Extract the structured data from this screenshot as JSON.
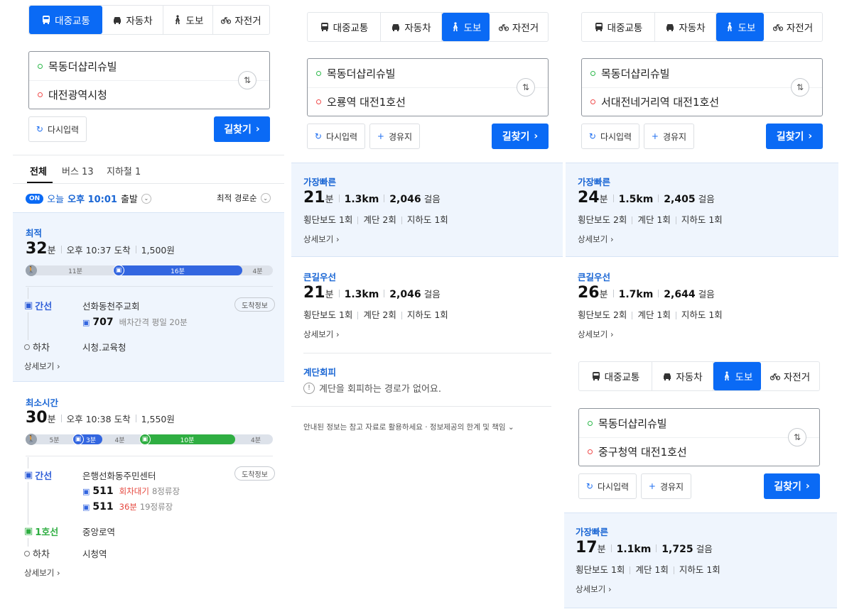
{
  "modes": {
    "transit": "대중교통",
    "car": "자동차",
    "walk": "도보",
    "bike": "자전거"
  },
  "col1": {
    "origin": "목동더샵리슈빌",
    "destination": "대전광역시청",
    "reset": "다시입력",
    "search": "길찾기",
    "filters": {
      "all": "전체",
      "bus": "버스 13",
      "subway": "지하철 1"
    },
    "on_badge": "ON",
    "depart_prefix": "오늘",
    "depart_time": "오후 10:01",
    "depart_suffix": "출발",
    "sort": "최적 경로순",
    "route1": {
      "label": "최적",
      "minutes": "32",
      "min_unit": "분",
      "arrive": "오후 10:37 도착",
      "fare": "1,500원",
      "seg_walk1": "11분",
      "seg_bus": "16분",
      "seg_walk2": "4분",
      "line": "간선",
      "stop": "선화동천주교회",
      "info": "도착정보",
      "bus_no": "707",
      "bus_note": "배차간격 평일 20분",
      "off": "하차",
      "off_stop": "시청.교육청",
      "more": "상세보기"
    },
    "route2": {
      "label": "최소시간",
      "minutes": "30",
      "min_unit": "분",
      "arrive": "오후 10:38 도착",
      "fare": "1,550원",
      "seg_walk1": "5분",
      "seg_bus": "3분",
      "seg_walk2": "4분",
      "seg_sub": "10분",
      "seg_walk3": "4분",
      "line": "간선",
      "stop": "은행선화동주민센터",
      "info": "도착정보",
      "bus1_no": "511",
      "bus1_status": "회차대기",
      "bus1_stops": "8정류장",
      "bus2_no": "511",
      "bus2_status": "36분",
      "bus2_stops": "19정류장",
      "subway": "1호선",
      "subway_stop": "중앙로역",
      "off": "하차",
      "off_stop": "시청역",
      "more": "상세보기"
    }
  },
  "col2": {
    "origin": "목동더샵리슈빌",
    "destination": "오룡역 대전1호선",
    "reset": "다시입력",
    "waypoint": "경유지",
    "search": "길찾기",
    "fastest": {
      "label": "가장빠른",
      "minutes": "21",
      "min_unit": "분",
      "dist": "1.3km",
      "steps": "2,046",
      "steps_unit": "걸음",
      "crosswalk": "횡단보도 1회",
      "stairs": "계단 2회",
      "underpass": "지하도 1회",
      "more": "상세보기"
    },
    "main_road": {
      "label": "큰길우선",
      "minutes": "21",
      "min_unit": "분",
      "dist": "1.3km",
      "steps": "2,046",
      "steps_unit": "걸음",
      "crosswalk": "횡단보도 1회",
      "stairs": "계단 2회",
      "underpass": "지하도 1회",
      "more": "상세보기"
    },
    "avoid_stairs": {
      "label": "계단회피",
      "message": "계단을 회피하는 경로가 없어요."
    },
    "notice": "안내된 정보는 참고 자료로 활용하세요 · 정보제공의 한계 및 책임"
  },
  "col3": {
    "origin": "목동더샵리슈빌",
    "destination": "서대전네거리역 대전1호선",
    "reset": "다시입력",
    "waypoint": "경유지",
    "search": "길찾기",
    "fastest": {
      "label": "가장빠른",
      "minutes": "24",
      "min_unit": "분",
      "dist": "1.5km",
      "steps": "2,405",
      "steps_unit": "걸음",
      "crosswalk": "횡단보도 2회",
      "stairs": "계단 1회",
      "underpass": "지하도 1회",
      "more": "상세보기"
    },
    "main_road": {
      "label": "큰길우선",
      "minutes": "26",
      "min_unit": "분",
      "dist": "1.7km",
      "steps": "2,644",
      "steps_unit": "걸음",
      "crosswalk": "횡단보도 2회",
      "stairs": "계단 1회",
      "underpass": "지하도 1회",
      "more": "상세보기"
    }
  },
  "col4": {
    "origin": "목동더샵리슈빌",
    "destination": "중구청역 대전1호선",
    "reset": "다시입력",
    "waypoint": "경유지",
    "search": "길찾기",
    "fastest": {
      "label": "가장빠른",
      "minutes": "17",
      "min_unit": "분",
      "dist": "1.1km",
      "steps": "1,725",
      "steps_unit": "걸음",
      "crosswalk": "횡단보도 1회",
      "stairs": "계단 1회",
      "underpass": "지하도 1회",
      "more": "상세보기"
    }
  },
  "colors": {
    "accent": "#0a6af5",
    "bus": "#3366e0",
    "subway": "#2fae42",
    "walk": "#9aa3ae",
    "card_bg": "#eff5fd"
  }
}
